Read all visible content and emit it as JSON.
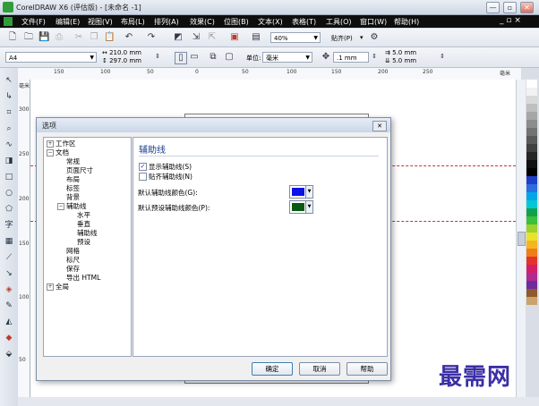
{
  "window": {
    "title": "CorelDRAW X6 (评估版) - [未命名 -1]",
    "buttons": [
      "—",
      "▫",
      "✕"
    ]
  },
  "menu": {
    "items": [
      "文件(F)",
      "编辑(E)",
      "视图(V)",
      "布局(L)",
      "排列(A)",
      "效果(C)",
      "位图(B)",
      "文本(X)",
      "表格(T)",
      "工具(O)",
      "窗口(W)",
      "帮助(H)"
    ],
    "doc_controls": "_ ▫ ×"
  },
  "toolbar": {
    "zoom": "40%",
    "snap_label": "贴齐(P)"
  },
  "propbar": {
    "page_size": "A4",
    "width": "210.0 mm",
    "height": "297.0 mm",
    "units_label": "单位:",
    "units": "毫米",
    "nudge": ".1 mm",
    "dup_x": "5.0 mm",
    "dup_y": "5.0 mm"
  },
  "ruler": {
    "top": [
      "150",
      "100",
      "50",
      "0",
      "50",
      "100",
      "150",
      "200",
      "250"
    ],
    "unit": "毫米",
    "left_unit": "毫米",
    "left": [
      "300",
      "250",
      "200",
      "150",
      "100",
      "50"
    ]
  },
  "dialog": {
    "title": "选项",
    "close": "✕",
    "tree": {
      "workspace": "工作区",
      "document": "文档",
      "general": "常规",
      "page_size": "页面尺寸",
      "layout": "布局",
      "label": "标签",
      "background": "背景",
      "guidelines": "辅助线",
      "horizontal": "水平",
      "vertical": "垂直",
      "guides": "辅助线",
      "presets": "预设",
      "grid": "网格",
      "rulers": "标尺",
      "save": "保存",
      "export_html": "导出 HTML",
      "global": "全局"
    },
    "panel": {
      "title": "辅助线",
      "show_guides": "显示辅助线(S)",
      "show_guides_checked": true,
      "snap_guides": "贴齐辅助线(N)",
      "snap_guides_checked": false,
      "default_color_label": "默认辅助线颜色(G):",
      "default_color": "#0a12e6",
      "preset_color_label": "默认预设辅助线颜色(P):",
      "preset_color": "#0a5a12"
    },
    "buttons": {
      "ok": "确定",
      "cancel": "取消",
      "help": "帮助"
    }
  },
  "watermark": "最需网",
  "palette": [
    "#ffffff",
    "#f2f2f2",
    "#d9d9d9",
    "#bfbfbf",
    "#a6a6a6",
    "#8c8c8c",
    "#737373",
    "#595959",
    "#404040",
    "#262626",
    "#111111",
    "#000000",
    "#1f3ec7",
    "#2a6ee0",
    "#00a6e8",
    "#00c8d6",
    "#13a04c",
    "#3cbf3a",
    "#9ad12b",
    "#e8e22a",
    "#f5b51f",
    "#f07d18",
    "#e3342b",
    "#d21f66",
    "#b02a8f",
    "#6e2b9c",
    "#8f5b2e",
    "#c9a36b"
  ]
}
